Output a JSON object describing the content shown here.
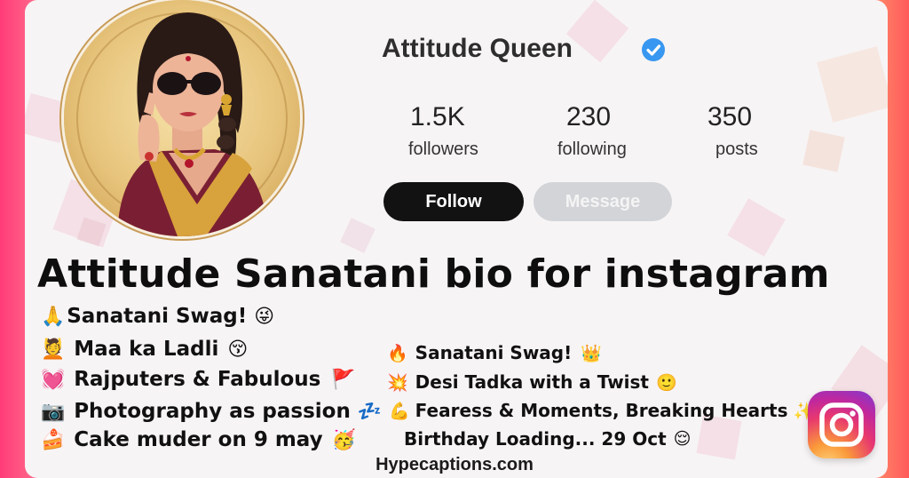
{
  "profile": {
    "name": "Attitude Queen",
    "stats": [
      {
        "value": "1.5K",
        "label": "followers"
      },
      {
        "value": "230",
        "label": "following"
      },
      {
        "value": "350",
        "label": "posts"
      }
    ],
    "follow_label": "Follow",
    "message_label": "Message"
  },
  "headline": "Attitude Sanatani bio for instagram",
  "bio_left": [
    {
      "emoji_start": "🙏",
      "text": "Sanatani Swag!",
      "emoji_end": "😜"
    },
    {
      "emoji_start": "💆",
      "text": "Maa ka Ladli",
      "emoji_end": "😚"
    },
    {
      "emoji_start": "💓",
      "text": "Rajputers & Fabulous",
      "emoji_end": "🚩"
    },
    {
      "emoji_start": "📷",
      "text": "Photography as passion",
      "emoji_end": "💤"
    },
    {
      "emoji_start": "🍰",
      "text": "Cake muder on 9 may",
      "emoji_end": "🥳"
    }
  ],
  "bio_right": [
    {
      "emoji_start": "🔥",
      "text": "Sanatani Swag!",
      "emoji_end": "👑"
    },
    {
      "emoji_start": "💥",
      "text": "Desi Tadka with a Twist",
      "emoji_end": "🙂"
    },
    {
      "emoji_start": "💪",
      "text": "Fearess & Moments, Breaking Hearts",
      "emoji_end": "✨"
    },
    {
      "emoji_start": "",
      "text": "Birthday Loading... 29 Oct",
      "emoji_end": "😌"
    }
  ],
  "footer": "Hypecaptions.com",
  "colors": {
    "verified": "#3897f0",
    "follow_bg": "#121212",
    "message_bg": "#d2d4d8"
  },
  "icons": {
    "verified": "verified-badge-icon",
    "instagram": "instagram-logo-icon"
  }
}
